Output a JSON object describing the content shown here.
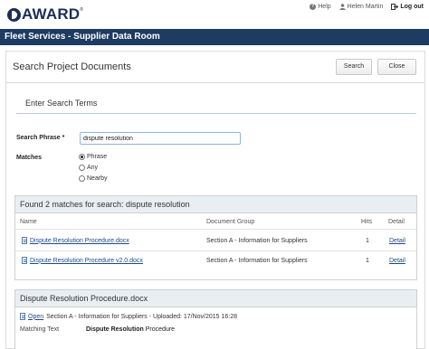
{
  "app": {
    "logo_text": "AWARD",
    "logo_tm": "®",
    "help_label": "Help",
    "user_name": "Helen Martin",
    "logout_label": "Log out"
  },
  "titlebar": {
    "title": "Fleet Services - Supplier Data Room"
  },
  "page": {
    "title": "Search Project Documents",
    "search_button": "Search",
    "close_button": "Close"
  },
  "search_form": {
    "section_title": "Enter Search Terms",
    "phrase_label": "Search Phrase *",
    "phrase_value": "dispute resolution",
    "matches_label": "Matches",
    "options": [
      {
        "label": "Phrase",
        "checked": true
      },
      {
        "label": "Any",
        "checked": false
      },
      {
        "label": "Nearby",
        "checked": false
      }
    ]
  },
  "results": {
    "header": "Found 2 matches for search: dispute resolution",
    "columns": {
      "name": "Name",
      "group": "Document Group",
      "hits": "Hits",
      "detail": "Detail"
    },
    "rows": [
      {
        "name": "Dispute Resolution Procedure.docx",
        "group": "Section A - Information for Suppliers",
        "hits": "1",
        "detail": "Detail"
      },
      {
        "name": "Dispute Resolution Procedure v2.0.docx",
        "group": "Section A - Information for Suppliers",
        "hits": "1",
        "detail": "Detail"
      }
    ]
  },
  "detail": {
    "header": "Dispute Resolution Procedure.docx",
    "open_label": "Open",
    "info": "Section A - Information for Suppliers - Uploaded: 17/Nov/2015 16:28",
    "matching_label": "Matching Text",
    "match_bold": "Dispute Resolution",
    "match_rest": " Procedure"
  },
  "colors": {
    "brand_navy": "#1c2f55",
    "titlebar": "#1e3b62",
    "link": "#1d4a85",
    "panel_header": "#e9eef3"
  }
}
